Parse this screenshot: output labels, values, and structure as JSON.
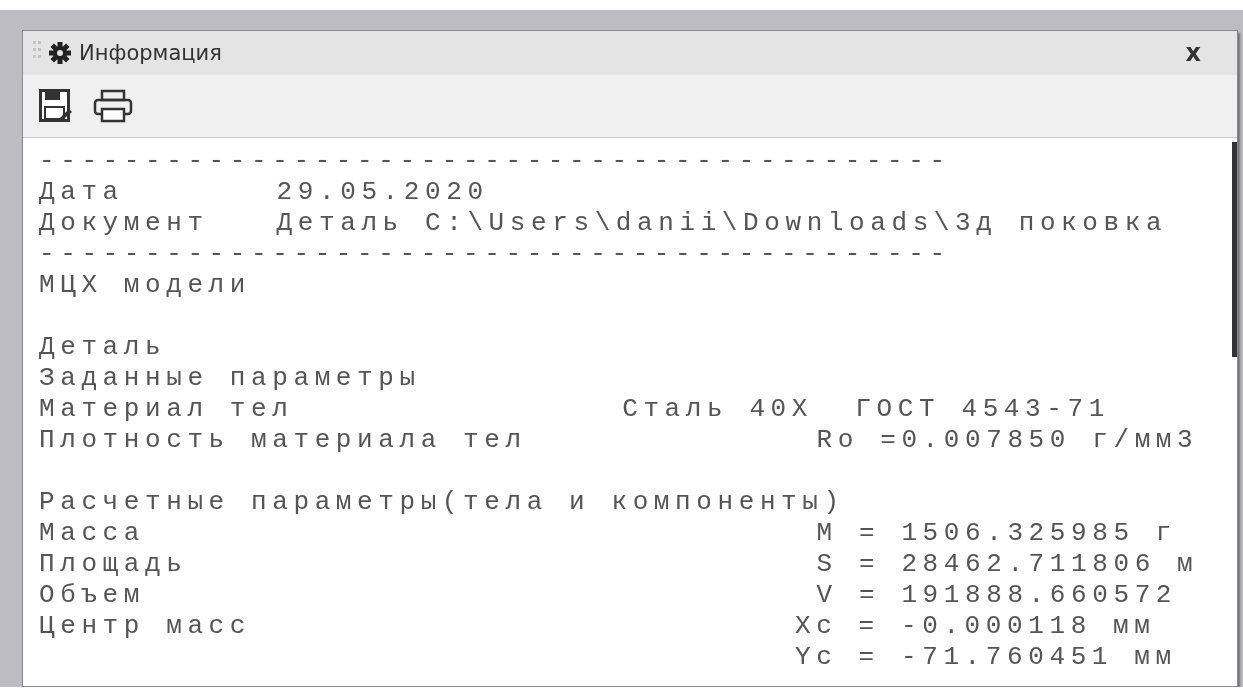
{
  "window": {
    "title": "Информация",
    "close": "x"
  },
  "toolbar": {
    "buttons": [
      {
        "kind": "save"
      },
      {
        "kind": "print"
      }
    ]
  },
  "report": {
    "lines": [
      {
        "kind": "rule",
        "text": "-------------------------------------------"
      },
      {
        "kind": "pair",
        "label": "Дата",
        "value": "29.05.2020"
      },
      {
        "kind": "pair",
        "label": "Документ",
        "value": "Деталь C:\\Users\\danii\\Downloads\\3д поковка"
      },
      {
        "kind": "rule",
        "text": "-------------------------------------------"
      },
      {
        "kind": "line",
        "text": "МЦХ модели"
      },
      {
        "kind": "blank"
      },
      {
        "kind": "line",
        "text": "Деталь"
      },
      {
        "kind": "line",
        "text": "Заданные параметры"
      },
      {
        "kind": "pair",
        "label": "Материал тел",
        "value": "Сталь 40Х  ГОСТ 4543-71"
      },
      {
        "kind": "pair",
        "label": "Плотность материала тел",
        "value": "Ro =0.007850 г/мм3"
      },
      {
        "kind": "blank"
      },
      {
        "kind": "line",
        "text": "Расчетные параметры(тела и компоненты)"
      },
      {
        "kind": "pair",
        "label": "Масса",
        "value": "M = 1506.325985 г"
      },
      {
        "kind": "pair",
        "label": "Площадь",
        "value": "S = 28462.711806 м"
      },
      {
        "kind": "pair",
        "label": "Объем",
        "value": "V = 191888.660572"
      },
      {
        "kind": "pair",
        "label": "Центр масс",
        "value": "Xc = -0.000118 мм"
      },
      {
        "kind": "pair",
        "value": "Yc = -71.760451 мм"
      }
    ]
  }
}
